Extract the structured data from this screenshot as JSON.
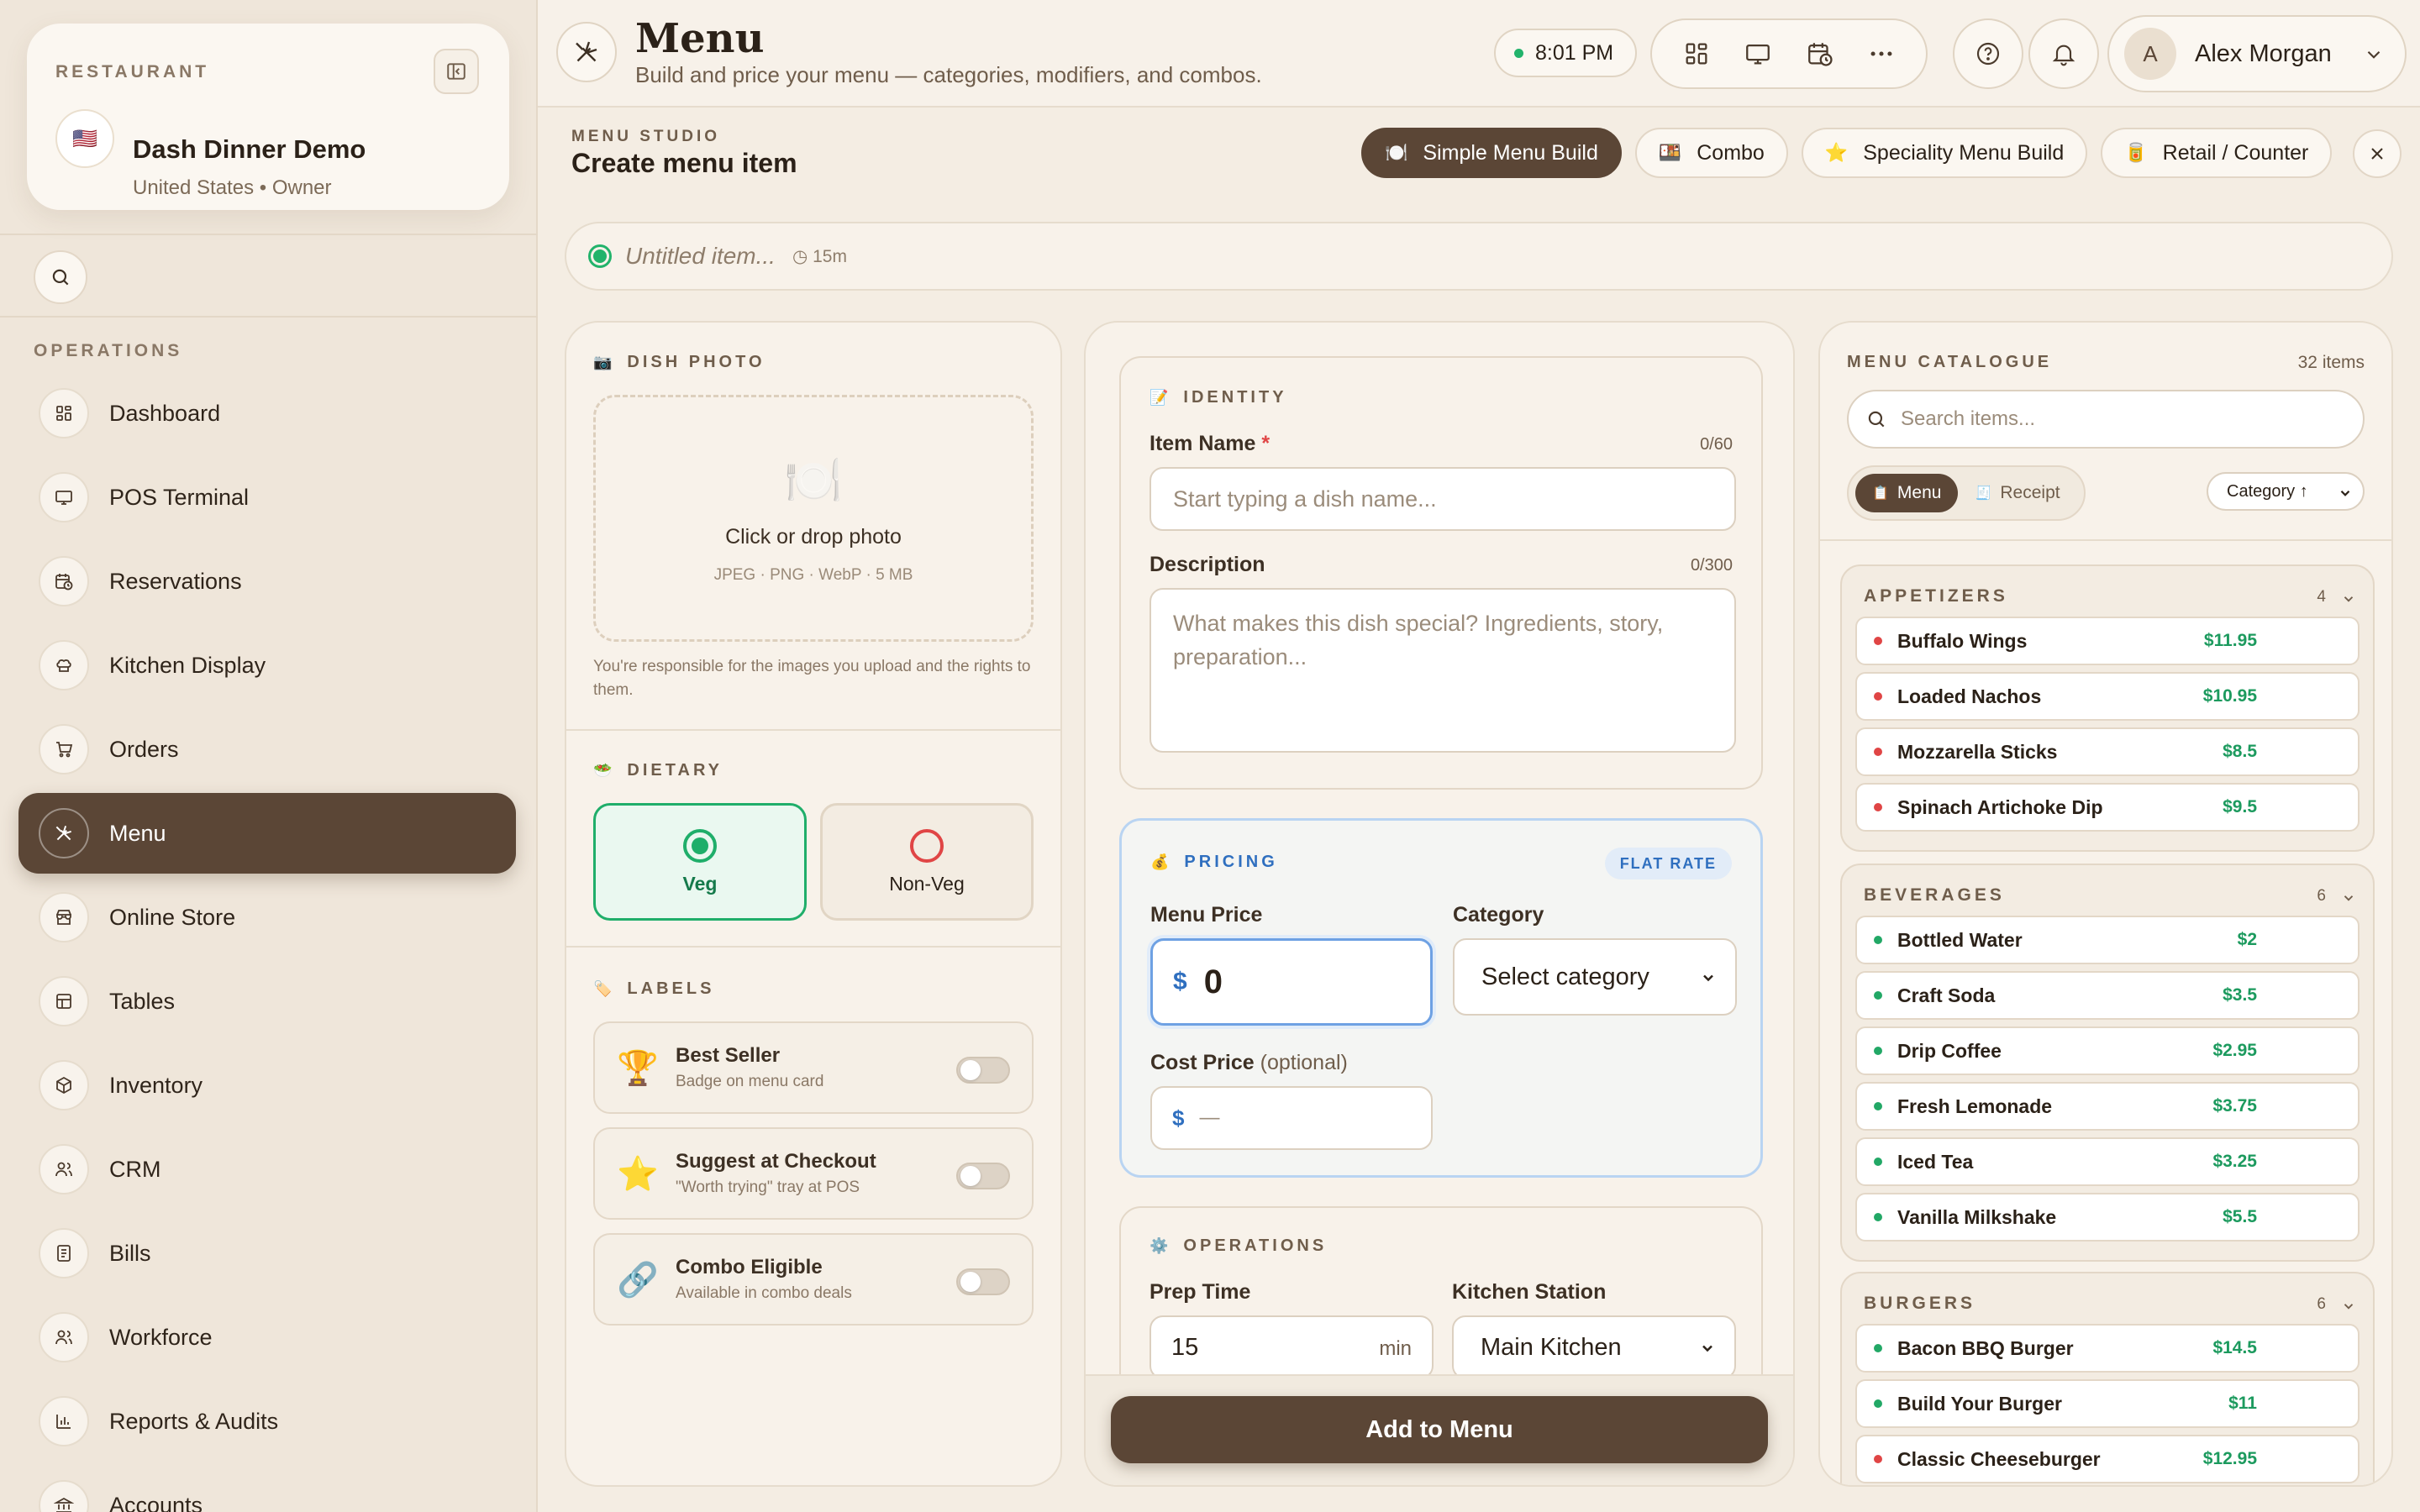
{
  "restaurant": {
    "eyebrow": "RESTAURANT",
    "name": "Dash Dinner Demo",
    "flag": "🇺🇸",
    "subtitle": "United States • Owner"
  },
  "sidebar": {
    "section_label": "OPERATIONS",
    "items": [
      {
        "label": "Dashboard",
        "icon": "dashboard-icon"
      },
      {
        "label": "POS Terminal",
        "icon": "monitor-icon"
      },
      {
        "label": "Reservations",
        "icon": "calendar-clock-icon"
      },
      {
        "label": "Kitchen Display",
        "icon": "chef-hat-icon"
      },
      {
        "label": "Orders",
        "icon": "cart-icon"
      },
      {
        "label": "Menu",
        "icon": "utensils-icon",
        "active": true
      },
      {
        "label": "Online Store",
        "icon": "store-icon"
      },
      {
        "label": "Tables",
        "icon": "table-icon"
      },
      {
        "label": "Inventory",
        "icon": "box-icon"
      },
      {
        "label": "CRM",
        "icon": "users-icon"
      },
      {
        "label": "Bills",
        "icon": "receipt-icon"
      },
      {
        "label": "Workforce",
        "icon": "team-icon"
      },
      {
        "label": "Reports & Audits",
        "icon": "bar-chart-icon"
      },
      {
        "label": "Accounts",
        "icon": "bank-icon"
      }
    ]
  },
  "header": {
    "title": "Menu",
    "subtitle": "Build and price your menu — categories, modifiers, and combos.",
    "time": "8:01 PM",
    "user": {
      "initial": "A",
      "name": "Alex Morgan"
    }
  },
  "studio": {
    "eyebrow": "MENU STUDIO",
    "title": "Create menu item",
    "modes": [
      {
        "label": "Simple Menu Build",
        "icon": "🍽️",
        "active": true
      },
      {
        "label": "Combo",
        "icon": "🍱"
      },
      {
        "label": "Speciality Menu Build",
        "icon": "⭐"
      },
      {
        "label": "Retail / Counter",
        "icon": "🥫"
      }
    ]
  },
  "item_bar": {
    "name_placeholder": "Untitled item...",
    "timer": "◷ 15m"
  },
  "photo": {
    "eyebrow": "DISH PHOTO",
    "eyebrow_icon": "📷",
    "plate_icon": "🍽️",
    "drop_text": "Click or drop photo",
    "formats": "JPEG · PNG · WebP · 5 MB",
    "note": "You're responsible for the images you upload and the rights to them."
  },
  "dietary": {
    "eyebrow": "DIETARY",
    "eyebrow_icon": "🥗",
    "options": [
      {
        "label": "Veg",
        "selected": true
      },
      {
        "label": "Non-Veg",
        "selected": false
      }
    ]
  },
  "labels": {
    "eyebrow": "LABELS",
    "eyebrow_icon": "🏷️",
    "items": [
      {
        "title": "Best Seller",
        "sub": "Badge on menu card",
        "icon": "🏆",
        "on": false
      },
      {
        "title": "Suggest at Checkout",
        "sub": "\"Worth trying\" tray at POS",
        "icon": "⭐",
        "on": false
      },
      {
        "title": "Combo Eligible",
        "sub": "Available in combo deals",
        "icon": "🔗",
        "on": false
      }
    ]
  },
  "identity": {
    "eyebrow": "IDENTITY",
    "eyebrow_icon": "📝",
    "name_label": "Item Name",
    "name_required": "*",
    "name_counter": "0/60",
    "name_placeholder": "Start typing a dish name...",
    "desc_label": "Description",
    "desc_counter": "0/300",
    "desc_placeholder": "What makes this dish special? Ingredients, story, preparation..."
  },
  "pricing": {
    "eyebrow": "PRICING",
    "eyebrow_icon": "💰",
    "badge": "FLAT RATE",
    "menu_price_label": "Menu Price",
    "currency": "$",
    "menu_price": "0",
    "category_label": "Category",
    "category_value": "Select category",
    "cost_label": "Cost Price",
    "cost_optional": "(optional)",
    "cost_value": "—"
  },
  "operations": {
    "eyebrow": "OPERATIONS",
    "eyebrow_icon": "⚙️",
    "prep_label": "Prep Time",
    "prep_value": "15",
    "prep_unit": "min",
    "station_label": "Kitchen Station",
    "station_value": "Main Kitchen"
  },
  "actions": {
    "add": "Add to Menu"
  },
  "catalogue": {
    "eyebrow": "MENU CATALOGUE",
    "count": "32 items",
    "search_placeholder": "Search items...",
    "views": [
      {
        "label": "Menu",
        "icon": "📋",
        "active": true
      },
      {
        "label": "Receipt",
        "icon": "🧾",
        "active": false
      }
    ],
    "sort": "Category ↑",
    "colors": {
      "veg": "#22a866",
      "nonveg": "#e04545"
    },
    "groups": [
      {
        "title": "APPETIZERS",
        "count": "4",
        "items": [
          {
            "name": "Buffalo Wings",
            "price": "$11.95",
            "veg": false
          },
          {
            "name": "Loaded Nachos",
            "price": "$10.95",
            "veg": false
          },
          {
            "name": "Mozzarella Sticks",
            "price": "$8.5",
            "veg": false
          },
          {
            "name": "Spinach Artichoke Dip",
            "price": "$9.5",
            "veg": false
          }
        ]
      },
      {
        "title": "BEVERAGES",
        "count": "6",
        "items": [
          {
            "name": "Bottled Water",
            "price": "$2",
            "veg": true
          },
          {
            "name": "Craft Soda",
            "price": "$3.5",
            "veg": true
          },
          {
            "name": "Drip Coffee",
            "price": "$2.95",
            "veg": true
          },
          {
            "name": "Fresh Lemonade",
            "price": "$3.75",
            "veg": true
          },
          {
            "name": "Iced Tea",
            "price": "$3.25",
            "veg": true
          },
          {
            "name": "Vanilla Milkshake",
            "price": "$5.5",
            "veg": true
          }
        ]
      },
      {
        "title": "BURGERS",
        "count": "6",
        "items": [
          {
            "name": "Bacon BBQ Burger",
            "price": "$14.5",
            "veg": true
          },
          {
            "name": "Build Your Burger",
            "price": "$11",
            "veg": true
          },
          {
            "name": "Classic Cheeseburger",
            "price": "$12.95",
            "veg": false
          }
        ]
      }
    ]
  }
}
